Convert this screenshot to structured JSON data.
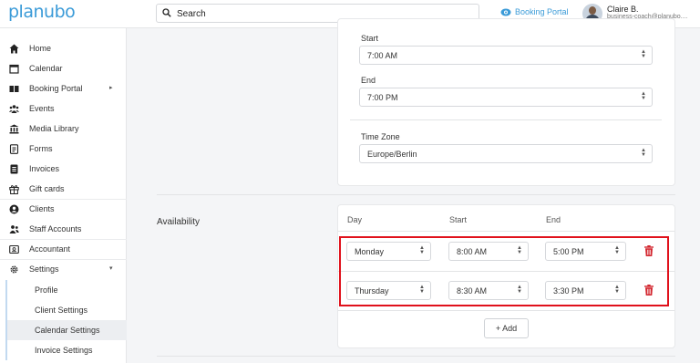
{
  "header": {
    "logo": "planubo",
    "search_placeholder": "Search",
    "portal_link": "Booking Portal",
    "user_name": "Claire B.",
    "user_email": "business-coach@planubo...."
  },
  "sidebar": {
    "items": [
      {
        "label": "Home",
        "icon": "home-icon"
      },
      {
        "label": "Calendar",
        "icon": "calendar-icon"
      },
      {
        "label": "Booking Portal",
        "icon": "book-icon",
        "caret": "▸"
      },
      {
        "label": "Events",
        "icon": "people-icon"
      },
      {
        "label": "Media Library",
        "icon": "library-icon"
      },
      {
        "label": "Forms",
        "icon": "forms-icon"
      },
      {
        "label": "Invoices",
        "icon": "invoice-icon"
      },
      {
        "label": "Gift cards",
        "icon": "gift-icon"
      },
      {
        "label": "Clients",
        "icon": "client-icon"
      },
      {
        "label": "Staff Accounts",
        "icon": "staff-icon"
      },
      {
        "label": "Accountant",
        "icon": "accountant-icon"
      },
      {
        "label": "Settings",
        "icon": "gear-icon",
        "caret": "▾"
      }
    ],
    "sub_items": [
      {
        "label": "Profile"
      },
      {
        "label": "Client Settings"
      },
      {
        "label": "Calendar Settings"
      },
      {
        "label": "Invoice Settings"
      }
    ]
  },
  "hours_card": {
    "start_label": "Start",
    "start_value": "7:00 AM",
    "end_label": "End",
    "end_value": "7:00 PM",
    "timezone_label": "Time Zone",
    "timezone_value": "Europe/Berlin"
  },
  "availability": {
    "section_title": "Availability",
    "col_day": "Day",
    "col_start": "Start",
    "col_end": "End",
    "rows": [
      {
        "day": "Monday",
        "start": "8:00 AM",
        "end": "5:00 PM"
      },
      {
        "day": "Thursday",
        "start": "8:30 AM",
        "end": "3:30 PM"
      }
    ],
    "add_label": "+ Add"
  },
  "colors": {
    "brand": "#3b9bd8",
    "highlight": "#e0111b",
    "trash": "#d3262f"
  }
}
